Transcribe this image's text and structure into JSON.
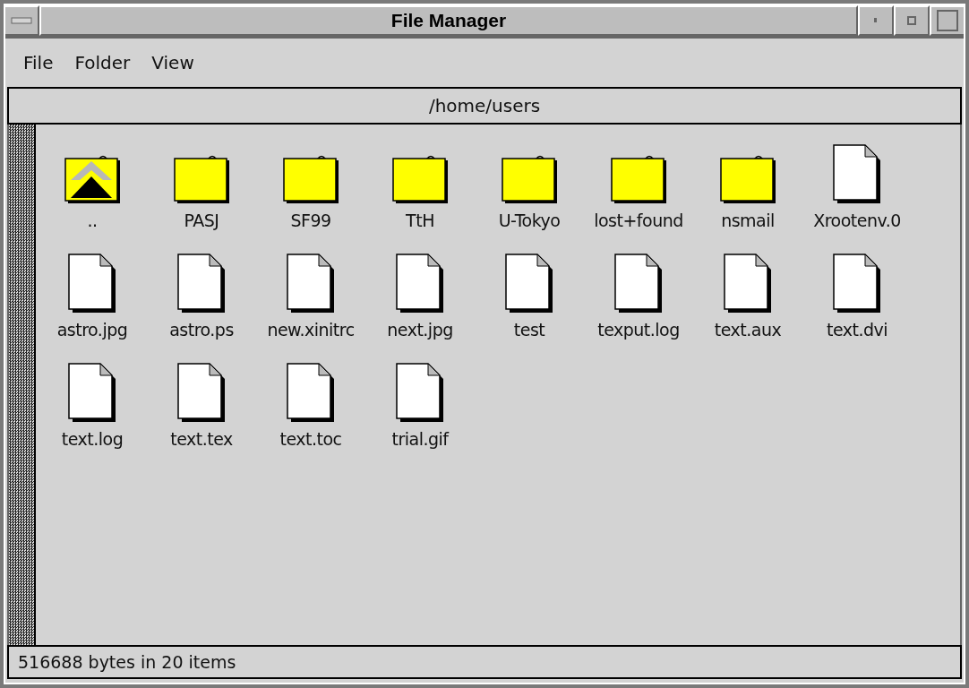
{
  "window": {
    "title": "File Manager"
  },
  "menu": [
    "File",
    "Folder",
    "View"
  ],
  "path": "/home/users",
  "items": [
    {
      "name": "..",
      "kind": "parent"
    },
    {
      "name": "PASJ",
      "kind": "folder"
    },
    {
      "name": "SF99",
      "kind": "folder"
    },
    {
      "name": "TtH",
      "kind": "folder"
    },
    {
      "name": "U-Tokyo",
      "kind": "folder"
    },
    {
      "name": "lost+found",
      "kind": "folder"
    },
    {
      "name": "nsmail",
      "kind": "folder"
    },
    {
      "name": "Xrootenv.0",
      "kind": "file"
    },
    {
      "name": "astro.jpg",
      "kind": "file"
    },
    {
      "name": "astro.ps",
      "kind": "file"
    },
    {
      "name": "new.xinitrc",
      "kind": "file"
    },
    {
      "name": "next.jpg",
      "kind": "file"
    },
    {
      "name": "test",
      "kind": "file"
    },
    {
      "name": "texput.log",
      "kind": "file"
    },
    {
      "name": "text.aux",
      "kind": "file"
    },
    {
      "name": "text.dvi",
      "kind": "file"
    },
    {
      "name": "text.log",
      "kind": "file"
    },
    {
      "name": "text.tex",
      "kind": "file"
    },
    {
      "name": "text.toc",
      "kind": "file"
    },
    {
      "name": "trial.gif",
      "kind": "file"
    }
  ],
  "status_bar": "516688 bytes in 20 items"
}
